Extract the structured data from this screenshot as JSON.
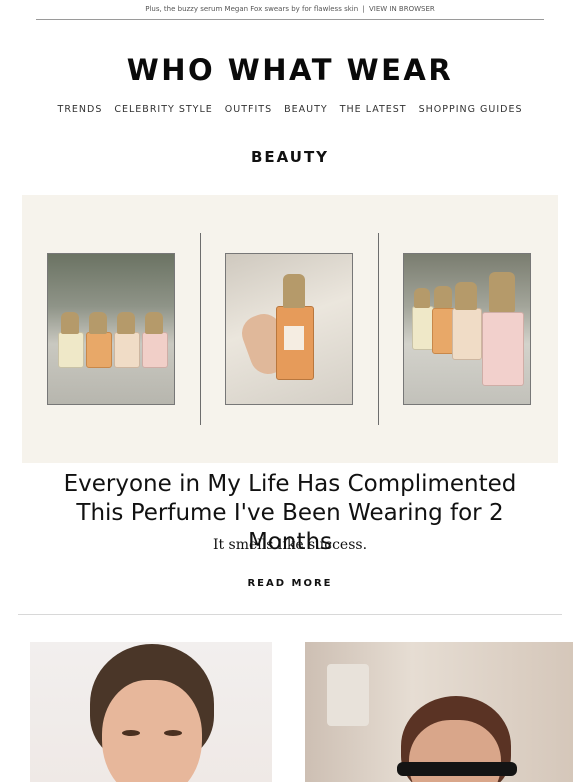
{
  "preheader": {
    "text": "Plus, the buzzy serum Megan Fox swears by for flawless skin",
    "separator": "|",
    "link": "VIEW IN BROWSER"
  },
  "logo": "WHO WHAT WEAR",
  "nav": [
    "TRENDS",
    "CELEBRITY STYLE",
    "OUTFITS",
    "BEAUTY",
    "THE LATEST",
    "SHOPPING GUIDES"
  ],
  "section_title": "BEAUTY",
  "article": {
    "headline": "Everyone in My Life Has Complimented This Perfume I've Been Wearing for 2 Months",
    "dek": "It smells like success.",
    "cta": "READ MORE"
  },
  "colors": {
    "hero_bg": "#f6f3ec",
    "text": "#111111",
    "rule": "#9a9a9a"
  }
}
